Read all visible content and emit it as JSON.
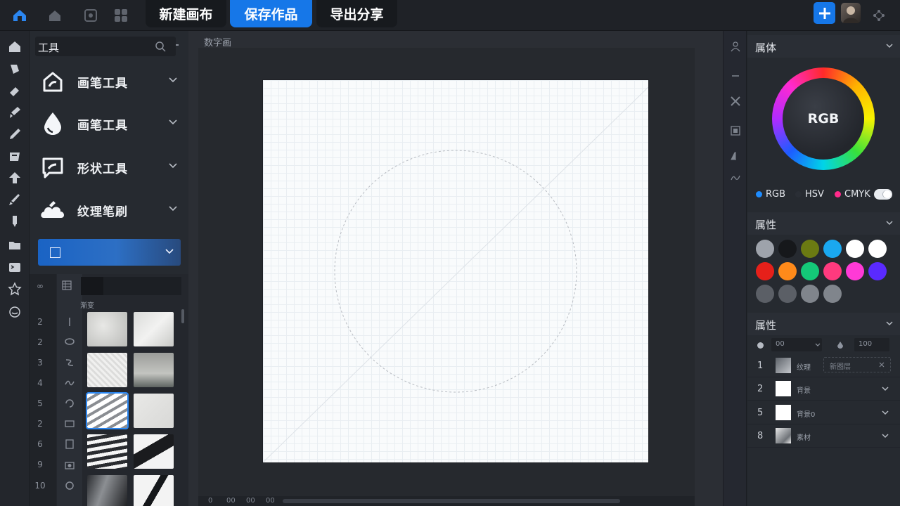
{
  "topbar": {
    "tabs": [
      {
        "label": "新建画布",
        "active": false
      },
      {
        "label": "保存作品",
        "active": true
      },
      {
        "label": "导出分享",
        "active": false
      }
    ]
  },
  "tools_panel": {
    "title": "工具",
    "tools": [
      {
        "label": "画笔工具",
        "icon": "brush-house-icon"
      },
      {
        "label": "画笔工具",
        "icon": "water-drop-icon"
      },
      {
        "label": "形状工具",
        "icon": "shape-board-icon"
      },
      {
        "label": "纹理笔刷",
        "icon": "texture-cloud-icon"
      }
    ],
    "sub_label": "渐变",
    "row_numbers": [
      "2",
      "2",
      "3",
      "4",
      "5",
      "2",
      "6",
      "9",
      "10"
    ]
  },
  "canvas": {
    "label": "数字画",
    "bottom_labels": [
      "0",
      "00",
      "00",
      "00"
    ]
  },
  "right_panel": {
    "color_section_title": "属体",
    "wheel_label": "RGB",
    "color_modes": [
      {
        "label": "RGB",
        "dot": "#1e8cff"
      },
      {
        "label": "HSV",
        "dot": "#2a2e35"
      },
      {
        "label": "CMYK",
        "dot": "#ff2a8a"
      }
    ],
    "swatch_section_title": "属性",
    "swatches": [
      "#9ea3ab",
      "#16181b",
      "#6b7a12",
      "#1aa8f0",
      "#ffffff",
      "#ffffff",
      "#e6201a",
      "#ff8a1a",
      "#14c878",
      "#ff3a7e",
      "#ff3ad6",
      "#5a2aff",
      "#5b5f66",
      "#5b5f66",
      "#80858c",
      "#80858c"
    ],
    "layer_section_title": "属性",
    "ctrl_dropdown": "00",
    "ctrl_number": "100",
    "layers": [
      {
        "num": "1",
        "name": "纹理",
        "field": "新图层"
      },
      {
        "num": "2",
        "name": "背景"
      },
      {
        "num": "5",
        "name": "背景0"
      },
      {
        "num": "8",
        "name": "素材"
      }
    ]
  }
}
